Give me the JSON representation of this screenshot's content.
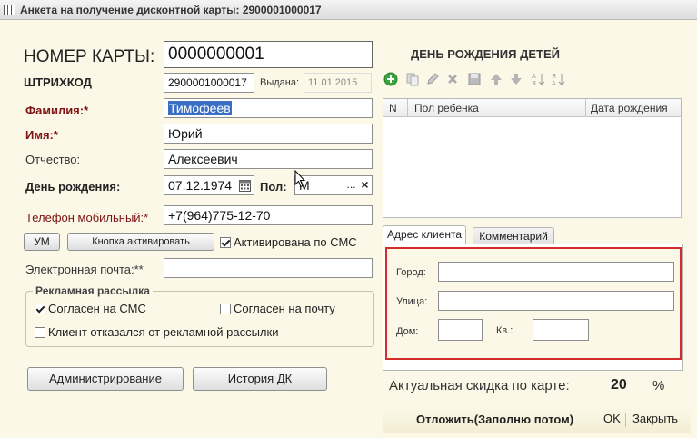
{
  "window": {
    "title": "Анкета на получение дисконтной карты: 2900001000017",
    "icon": "form-grid-icon"
  },
  "card": {
    "number_label": "НОМЕР КАРТЫ:",
    "number_value": "0000000001",
    "barcode_label": "ШТРИХКОД",
    "barcode_value": "2900001000017",
    "issued_label": "Выдана:",
    "issued_value": "11.01.2015"
  },
  "person": {
    "last_name_label": "Фамилия:*",
    "last_name_value": "Тимофеев",
    "first_name_label": "Имя:*",
    "first_name_value": "Юрий",
    "patronymic_label": "Отчество:",
    "patronymic_value": "Алексеевич",
    "birthday_label": "День рождения:",
    "birthday_value": "07.12.1974",
    "gender_label": "Пол:",
    "gender_value": "М",
    "gender_select_glyph": "...",
    "gender_clear_glyph": "×",
    "phone_label": "Телефон мобильный:*",
    "phone_value": "+7(964)775-12-70",
    "email_label": "Электронная почта:**",
    "email_value": ""
  },
  "actions": {
    "um_button": "УМ",
    "activate_button": "Кнопка активировать",
    "sms_activated_label": "Активирована по СМС",
    "sms_activated_checked": true,
    "admin_button": "Администрирование",
    "history_button": "История ДК"
  },
  "advertising": {
    "title": "Рекламная рассылка",
    "sms_label": "Согласен на СМС",
    "sms_checked": true,
    "mail_label": "Согласен на почту",
    "mail_checked": false,
    "refused_label": "Клиент отказался от рекламной рассылки",
    "refused_checked": false
  },
  "children": {
    "title": "ДЕНЬ РОЖДЕНИЯ ДЕТЕЙ",
    "toolbar": [
      "add-icon",
      "copy-icon",
      "edit-icon",
      "delete-icon",
      "save-icon",
      "move-up-icon",
      "move-down-icon",
      "sort-asc-icon",
      "sort-desc-icon"
    ],
    "columns": [
      "N",
      "Пол ребенка",
      "Дата рождения"
    ],
    "rows": []
  },
  "tabs": {
    "address": "Адрес клиента",
    "comment": "Комментарий"
  },
  "address": {
    "city_label": "Город:",
    "city_value": "",
    "street_label": "Улица:",
    "street_value": "",
    "house_label": "Дом:",
    "house_value": "",
    "apt_label": "Кв.:",
    "apt_value": ""
  },
  "discount": {
    "label": "Актуальная скидка по карте:",
    "value": "20",
    "unit": "%"
  },
  "footer": {
    "postpone": "Отложить(Заполню потом)",
    "ok": "OK",
    "close": "Закрыть"
  },
  "colors": {
    "background": "#fbf8e8",
    "required_label": "#7d1313",
    "highlight_border": "#d42b2b",
    "selection": "#3a6fc4",
    "toolbar_add": "#3aa53a"
  }
}
